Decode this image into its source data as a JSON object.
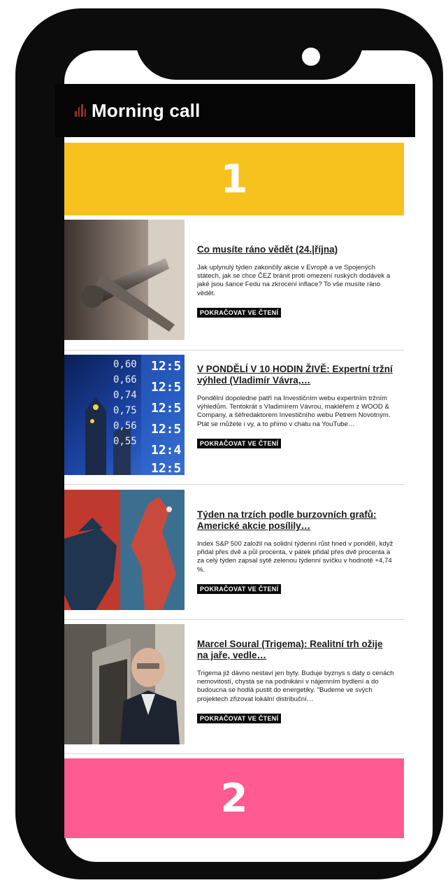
{
  "header": {
    "title": "Morning call"
  },
  "banners": {
    "first": "1",
    "second": "2"
  },
  "articles": [
    {
      "headline": "Co musíte ráno vědět (24.|října)",
      "excerpt": "Jak uplynulý týden zakončily akcie v Evropě a ve Spojených státech, jak se chce ČEZ bránit proti omezení ruských dodávek a jaké jsou šance Fedu na zkrocení inflace? To vše musíte ráno vědět.",
      "read_more": "POKRAČOVAT VE ČTENÍ"
    },
    {
      "headline": "V PONDĚLÍ V 10 HODIN ŽIVĚ: Expertní tržní výhled (Vladimír Vávra,…",
      "excerpt": "Pondělní dopoledne patří na Investičním webu expertním tržním výhledům. Tentokrát s Vladimírem Vávrou, makléřem z WOOD & Company, a šéfredaktorem Investičního webu Petrem Novotným. Ptát se můžete i vy, a to přímo v chatu na YouTube…",
      "read_more": "POKRAČOVAT VE ČTENÍ",
      "thumb_numbers_left": [
        "0,60",
        "0,66",
        "0,74",
        "0,75",
        "0,56",
        "0,55"
      ],
      "thumb_numbers_right": [
        "12:5",
        "12:5",
        "12:5",
        "12:5",
        "12:4",
        "12:5"
      ]
    },
    {
      "headline": "Týden na trzích podle burzovních grafů: Americké akcie posílily…",
      "excerpt": "Index S&P 500 založil na solidní týdenní růst hned v pondělí, když přidal přes dvě a půl procenta, v pátek přidal přes dvě procenta a za celý týden zapsal sytě zelenou týdenní svíčku v hodnotě +4,74 %.",
      "read_more": "POKRAČOVAT VE ČTENÍ"
    },
    {
      "headline": "Marcel Soural (Trigema): Realitní trh ožije na jaře, vedle…",
      "excerpt": "Trigema již dávno nestaví jen byty. Buduje byznys s daty o cenách nemovitostí, chystá se na podnikání v nájemním bydlení a do budoucna se hodlá pustit do energetiky. \"Budeme ve svých projektech zřizovat lokální distribuční…",
      "read_more": "POKRAČOVAT VE ČTENÍ"
    }
  ]
}
